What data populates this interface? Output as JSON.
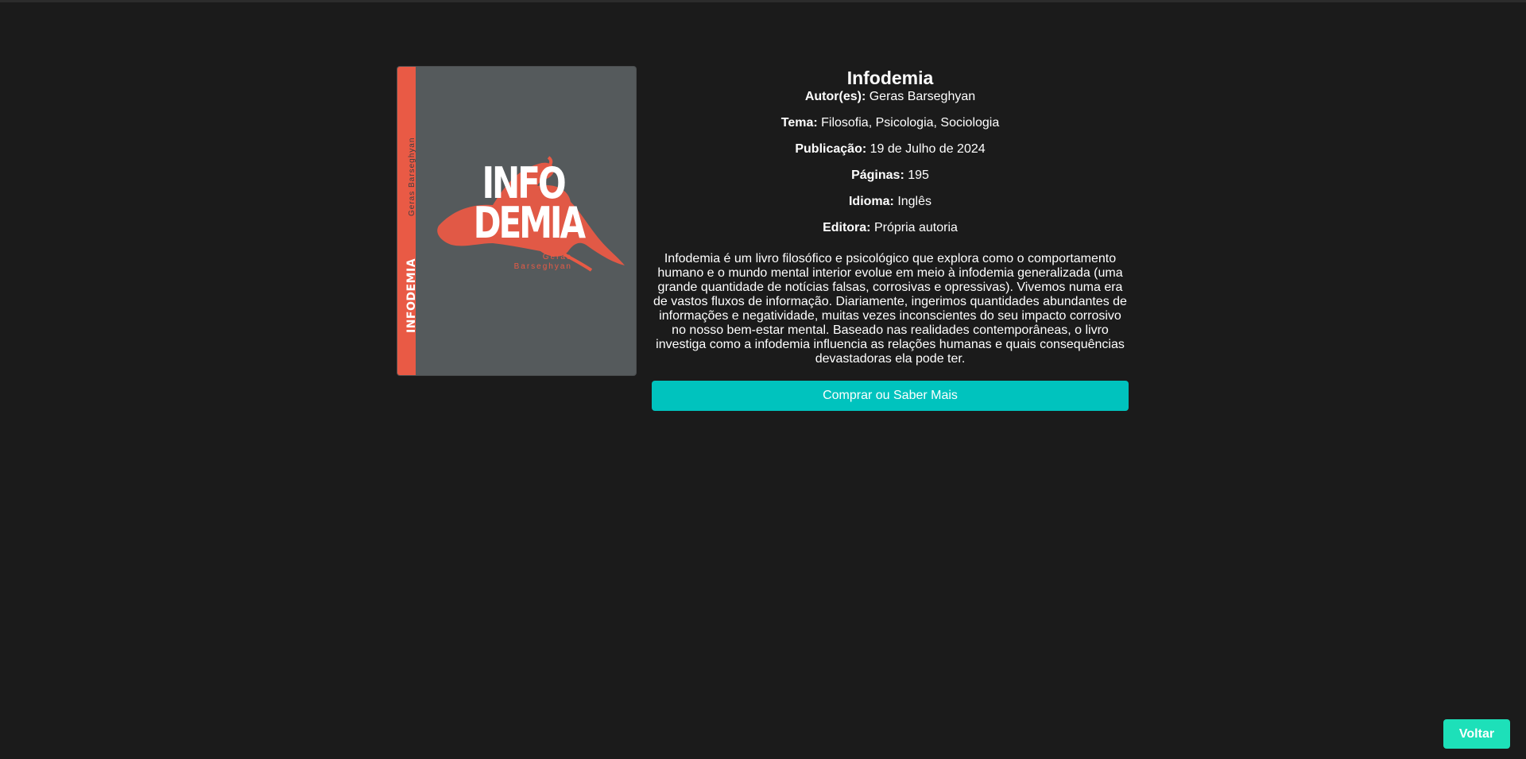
{
  "book": {
    "title": "Infodemia",
    "cover": {
      "spine_title": "INFODEMIA",
      "spine_author": "Geras Barseghyan",
      "title_line1": "INFO",
      "title_line2": "DEMIA",
      "author_line1": "Geras",
      "author_line2": "Barseghyan",
      "accent_color": "#e95a45",
      "background_color": "#555a5c"
    },
    "details": [
      {
        "label": "Autor(es):",
        "value": "Geras Barseghyan"
      },
      {
        "label": "Tema:",
        "value": "Filosofia, Psicologia, Sociologia"
      },
      {
        "label": "Publicação:",
        "value": "19 de Julho de 2024"
      },
      {
        "label": "Páginas:",
        "value": "195"
      },
      {
        "label": "Idioma:",
        "value": "Inglês"
      },
      {
        "label": "Editora:",
        "value": "Própria autoria"
      }
    ],
    "description": "Infodemia é um livro filosófico e psicológico que explora como o comportamento humano e o mundo mental interior evolue em meio à infodemia generalizada (uma grande quantidade de notícias falsas, corrosivas e opressivas). Vivemos numa era de vastos fluxos de informação. Diariamente, ingerimos quantidades abundantes de informações e negatividade, muitas vezes inconscientes do seu impacto corrosivo no nosso bem-estar mental. Baseado nas realidades contemporâneas, o livro investiga como a infodemia influencia as relações humanas e quais consequências devastadoras ela pode ter."
  },
  "actions": {
    "buy_label": "Comprar ou Saber Mais",
    "back_label": "Voltar"
  },
  "colors": {
    "page_background": "#1b1b1b",
    "buy_button": "#00c3be",
    "back_button": "#1de0b9"
  }
}
